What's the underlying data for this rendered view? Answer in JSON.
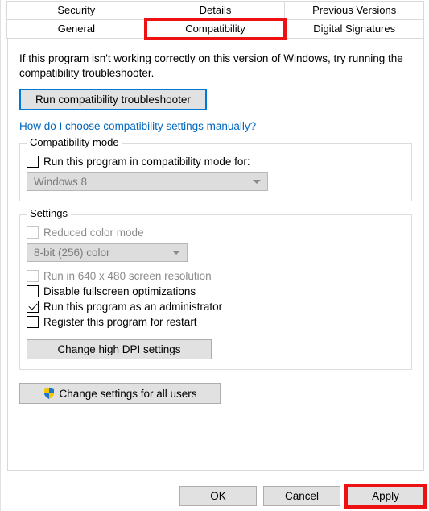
{
  "tabs": {
    "row1": [
      "Security",
      "Details",
      "Previous Versions"
    ],
    "row2": [
      "General",
      "Compatibility",
      "Digital Signatures"
    ],
    "active": "Compatibility"
  },
  "intro": "If this program isn't working correctly on this version of Windows, try running the compatibility troubleshooter.",
  "troubleshoot_btn": "Run compatibility troubleshooter",
  "help_link": "How do I choose compatibility settings manually?",
  "compat_group": {
    "title": "Compatibility mode",
    "checkbox_label": "Run this program in compatibility mode for:",
    "combo_value": "Windows 8"
  },
  "settings_group": {
    "title": "Settings",
    "reduced_color": "Reduced color mode",
    "color_combo": "8-bit (256) color",
    "run_640": "Run in 640 x 480 screen resolution",
    "disable_fs": "Disable fullscreen optimizations",
    "run_admin": "Run this program as an administrator",
    "register_restart": "Register this program for restart",
    "dpi_btn": "Change high DPI settings"
  },
  "all_users_btn": "Change settings for all users",
  "footer": {
    "ok": "OK",
    "cancel": "Cancel",
    "apply": "Apply"
  }
}
